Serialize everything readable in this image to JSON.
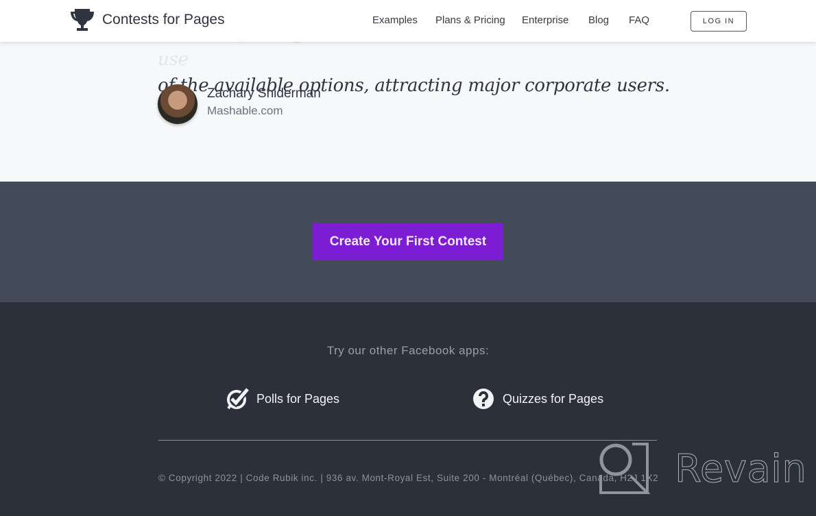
{
  "header": {
    "logo_text": "Contests for Pages",
    "nav": [
      "Examples",
      "Plans & Pricing",
      "Enterprise",
      "Blog",
      "FAQ"
    ],
    "login_label": "LOG IN"
  },
  "testimonial": {
    "quote_line1": "Contests for Pages is the most customizable and easiest to use",
    "quote_line2": "of the available options, attracting major corporate users.",
    "author_name": "Zachary Sniderman",
    "author_site": "Mashable.com"
  },
  "cta": {
    "label": "Create Your First Contest",
    "color": "#7c1dd4"
  },
  "footer": {
    "try_label": "Try our other Facebook apps:",
    "apps": [
      {
        "label": "Polls for Pages",
        "icon": "check-bubble-icon"
      },
      {
        "label": "Quizzes for Pages",
        "icon": "question-circle-icon"
      }
    ],
    "copyright": "© Copyright 2022 | Code Rubik inc. | 936 av. Mont-Royal Est, Suite 200 - Montréal (Québec), Canada, H2J 1X2"
  },
  "watermark": {
    "text": "Revain"
  }
}
